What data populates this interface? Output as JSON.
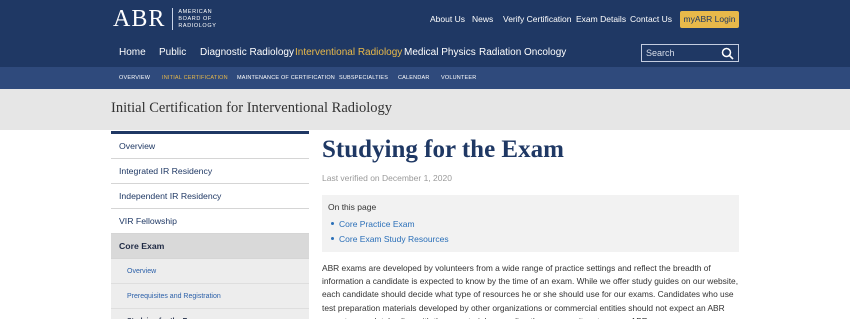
{
  "logo": {
    "abbr": "ABR",
    "lines": [
      "American",
      "Board of",
      "Radiology"
    ]
  },
  "utility_nav": [
    "About Us",
    "News",
    "Verify Certification",
    "Exam Details",
    "Contact Us"
  ],
  "login_label": "myABR Login",
  "main_nav": {
    "items": [
      "Home",
      "Public",
      "Diagnostic Radiology",
      "Interventional Radiology",
      "Medical Physics",
      "Radiation Oncology"
    ],
    "active": "Interventional Radiology"
  },
  "search": {
    "placeholder": "Search"
  },
  "sub_nav": {
    "items": [
      "Overview",
      "Initial Certification",
      "Maintenance of Certification",
      "Subspecialties",
      "Calendar",
      "Volunteer"
    ],
    "active": "Initial Certification"
  },
  "section_title": "Initial Certification for Interventional Radiology",
  "sidebar": {
    "items": [
      {
        "label": "Overview",
        "level": 1
      },
      {
        "label": "Integrated IR Residency",
        "level": 1
      },
      {
        "label": "Independent IR Residency",
        "level": 1
      },
      {
        "label": "VIR Fellowship",
        "level": 1
      },
      {
        "label": "Core Exam",
        "level": 1,
        "current": true
      },
      {
        "label": "Overview",
        "level": 2
      },
      {
        "label": "Prerequisites and Registration",
        "level": 2
      },
      {
        "label": "Studying for the Exam",
        "level": 2,
        "current": true
      }
    ]
  },
  "page": {
    "title": "Studying for the Exam",
    "verified": "Last verified on December 1, 2020",
    "on_this_page": {
      "heading": "On this page",
      "links": [
        "Core Practice Exam",
        "Core Exam Study Resources"
      ]
    },
    "paragraph": "ABR exams are developed by volunteers from a wide range of practice settings and reflect the breadth of information a candidate is expected to know by the time of an exam. While we offer study guides on our website, each candidate should decide what type of resources he or she should use for our exams. Candidates who use test preparation materials developed by other organizations or commercial entities should not expect an ABR exam to completely align with these materials regarding the scope or item types on ABR exams."
  },
  "colors": {
    "navy": "#1f3864",
    "subnav": "#2f4a7c",
    "gold": "#e8b94a",
    "link": "#2a6fb8"
  },
  "icons": {
    "search": "search-icon"
  }
}
